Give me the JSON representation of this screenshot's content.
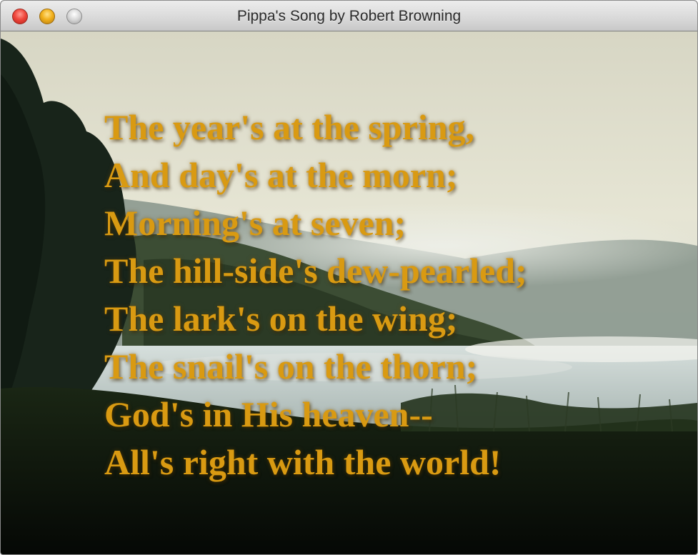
{
  "window": {
    "title": "Pippa's Song by Robert Browning",
    "buttons": [
      "close",
      "minimize",
      "zoom"
    ]
  },
  "background": {
    "description_icon": "misty-lake-photo",
    "colors": {
      "sky": "#e3e2cf",
      "forest": "#1b2a16",
      "water": "#b9c7c4",
      "grass": "#0c130a"
    }
  },
  "poem": {
    "text_color": "#d99a12",
    "lines": [
      "The year's at the spring,",
      "And day's at the morn;",
      "Morning's at seven;",
      "The hill-side's dew-pearled;",
      "The lark's on the wing;",
      "The snail's on the thorn;",
      "God's in His heaven--",
      "All's right with the world!"
    ]
  }
}
